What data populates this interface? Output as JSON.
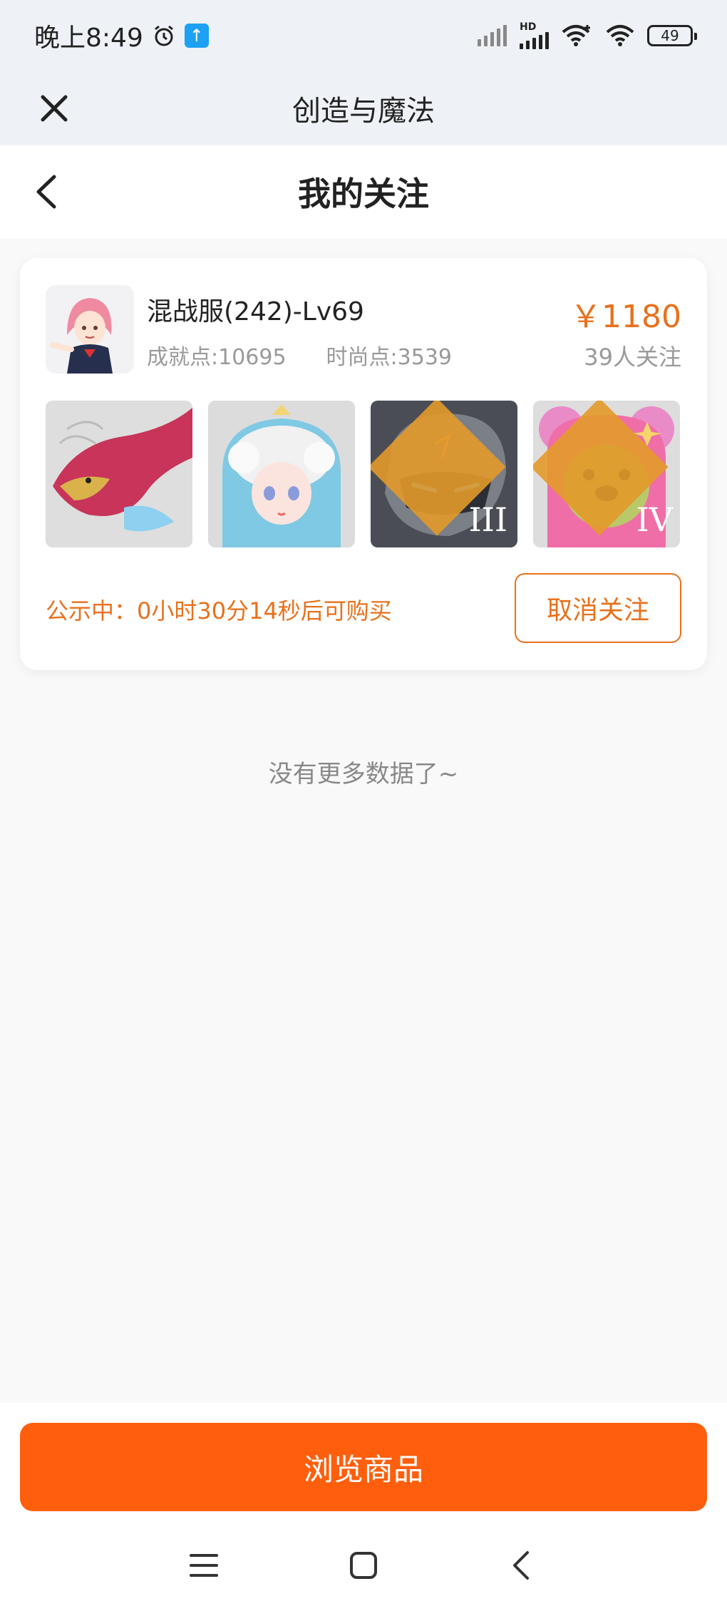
{
  "status_bar": {
    "time": "晚上8:49",
    "battery": "49",
    "network_label": "HD"
  },
  "app_header": {
    "title": "创造与魔法"
  },
  "page_header": {
    "title": "我的关注"
  },
  "listing": {
    "server": "混战服(242)-Lv69",
    "achievement_points": "成就点:10695",
    "fashion_points": "时尚点:3539",
    "price": "￥1180",
    "followers": "39人关注",
    "items": [
      {
        "icon": "dragon-mount-icon",
        "grade": ""
      },
      {
        "icon": "cloud-girl-pet-icon",
        "grade": ""
      },
      {
        "icon": "stone-golem-icon",
        "grade": "III"
      },
      {
        "icon": "pink-bear-icon",
        "grade": "IV"
      }
    ],
    "notice": "公示中：0小时30分14秒后可购买",
    "unfollow_label": "取消关注"
  },
  "no_more_text": "没有更多数据了~",
  "browse_label": "浏览商品",
  "colors": {
    "accent": "#e8711d",
    "primary_button": "#ff5f0d",
    "header_bg": "#eef2f6"
  }
}
